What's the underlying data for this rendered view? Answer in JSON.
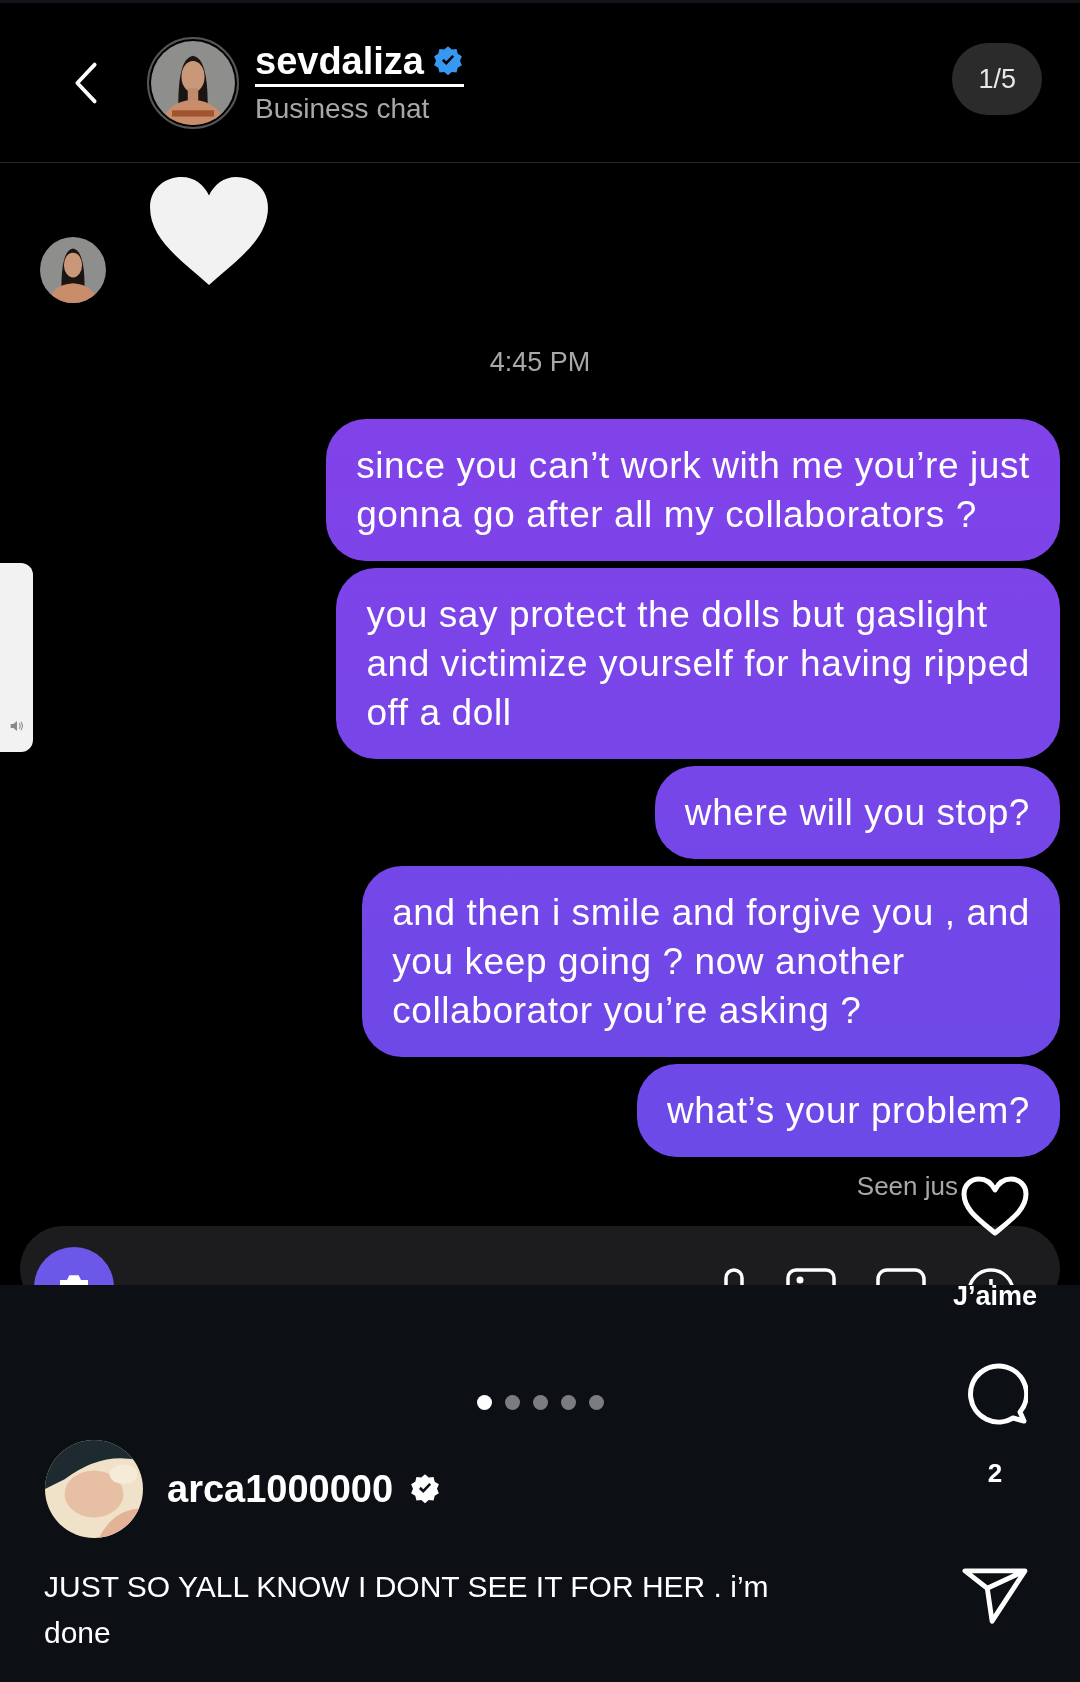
{
  "chat": {
    "header": {
      "contact_name": "sevdaliza",
      "verified": true,
      "subtitle": "Business chat",
      "page_counter": "1/5"
    },
    "messages": [
      {
        "kind": "heart"
      },
      {
        "kind": "timestamp",
        "text": "4:45 PM"
      },
      {
        "kind": "text",
        "text": "since you can’t work with me you’re just\ngonna go after all my collaborators ?"
      },
      {
        "kind": "text",
        "text": "you say protect the dolls but gaslight\nand victimize yourself for having ripped\noff a doll"
      },
      {
        "kind": "text",
        "text": "where will you stop?"
      },
      {
        "kind": "text",
        "text": "and then i smile and forgive you , and\nyou keep going ? now another\ncollaborator you’re asking ?"
      },
      {
        "kind": "text",
        "text": "what’s your problem?"
      }
    ],
    "seen": "Seen jus"
  },
  "post": {
    "like_label": "J’aime",
    "liked": false,
    "comment_count": "2",
    "carousel": [
      {
        "selected": true
      },
      {
        "selected": false
      },
      {
        "selected": false
      },
      {
        "selected": false
      },
      {
        "selected": false
      }
    ],
    "author": "arca1000000",
    "verified": true,
    "caption": "JUST SO YALL KNOW I DONT SEE IT FOR HER . i’m done"
  }
}
